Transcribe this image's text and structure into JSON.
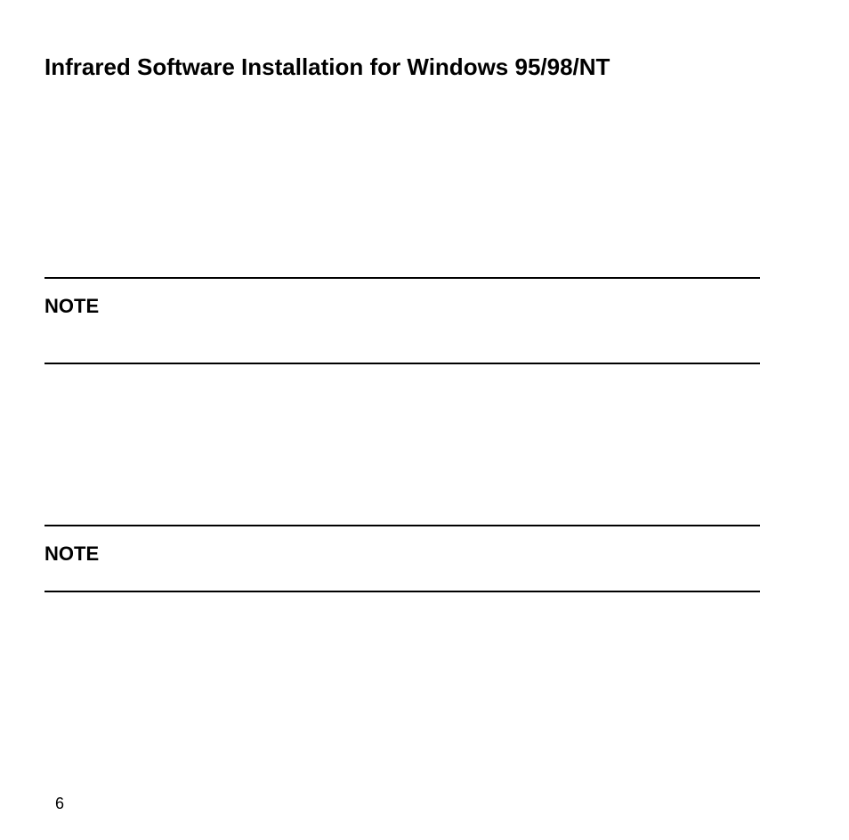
{
  "title": "Infrared Software Installation for Windows 95/98/NT",
  "notes": {
    "first_label": "NOTE",
    "second_label": "NOTE"
  },
  "page_number": "6"
}
